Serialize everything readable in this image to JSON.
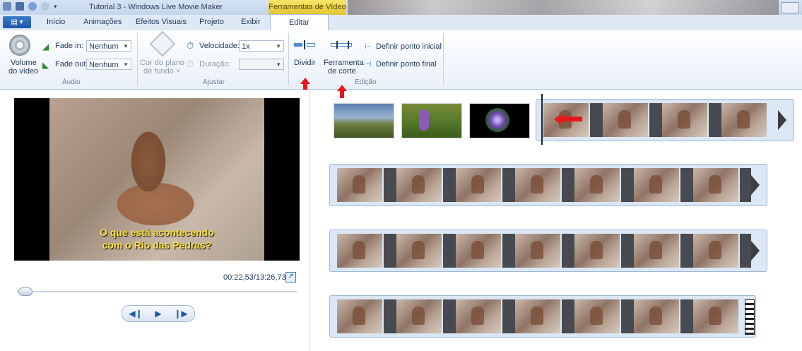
{
  "window": {
    "title": "Tutorial 3 - Windows Live Movie Maker",
    "context_tab": "Ferramentas de Vídeo"
  },
  "tabs": [
    {
      "label": "Início"
    },
    {
      "label": "Animações"
    },
    {
      "label": "Efeitos Visuais"
    },
    {
      "label": "Projeto"
    },
    {
      "label": "Exibir"
    },
    {
      "label": "Editar",
      "active": true
    }
  ],
  "ribbon": {
    "audio": {
      "group_label": "Áudio",
      "volume_label_1": "Volume",
      "volume_label_2": "do vídeo",
      "fade_in_label": "Fade in:",
      "fade_in_value": "Nenhum",
      "fade_out_label": "Fade out:",
      "fade_out_value": "Nenhum"
    },
    "adjust": {
      "group_label": "Ajustar",
      "bg_color_1": "Cor do plano",
      "bg_color_2": "de fundo ˅",
      "speed_label": "Velocidade:",
      "speed_value": "1x",
      "duration_label": "Duração:",
      "duration_value": ""
    },
    "edit": {
      "group_label": "Edição",
      "split_label": "Dividir",
      "trim_label_1": "Ferramenta",
      "trim_label_2": "de corte",
      "set_start": "Definir ponto inicial",
      "set_end": "Definir ponto final"
    }
  },
  "preview": {
    "caption_line1": "O que está acontecendo",
    "caption_line2": "com o Rio das Pedras?",
    "timecode": "00:22,53/13:26,73",
    "seek_fraction": 0.028
  },
  "colors": {
    "accent": "#1d56a8",
    "context_tab": "#e9cf3f",
    "annotation_red": "#e8161b",
    "caption_yellow": "#ffe23a"
  }
}
